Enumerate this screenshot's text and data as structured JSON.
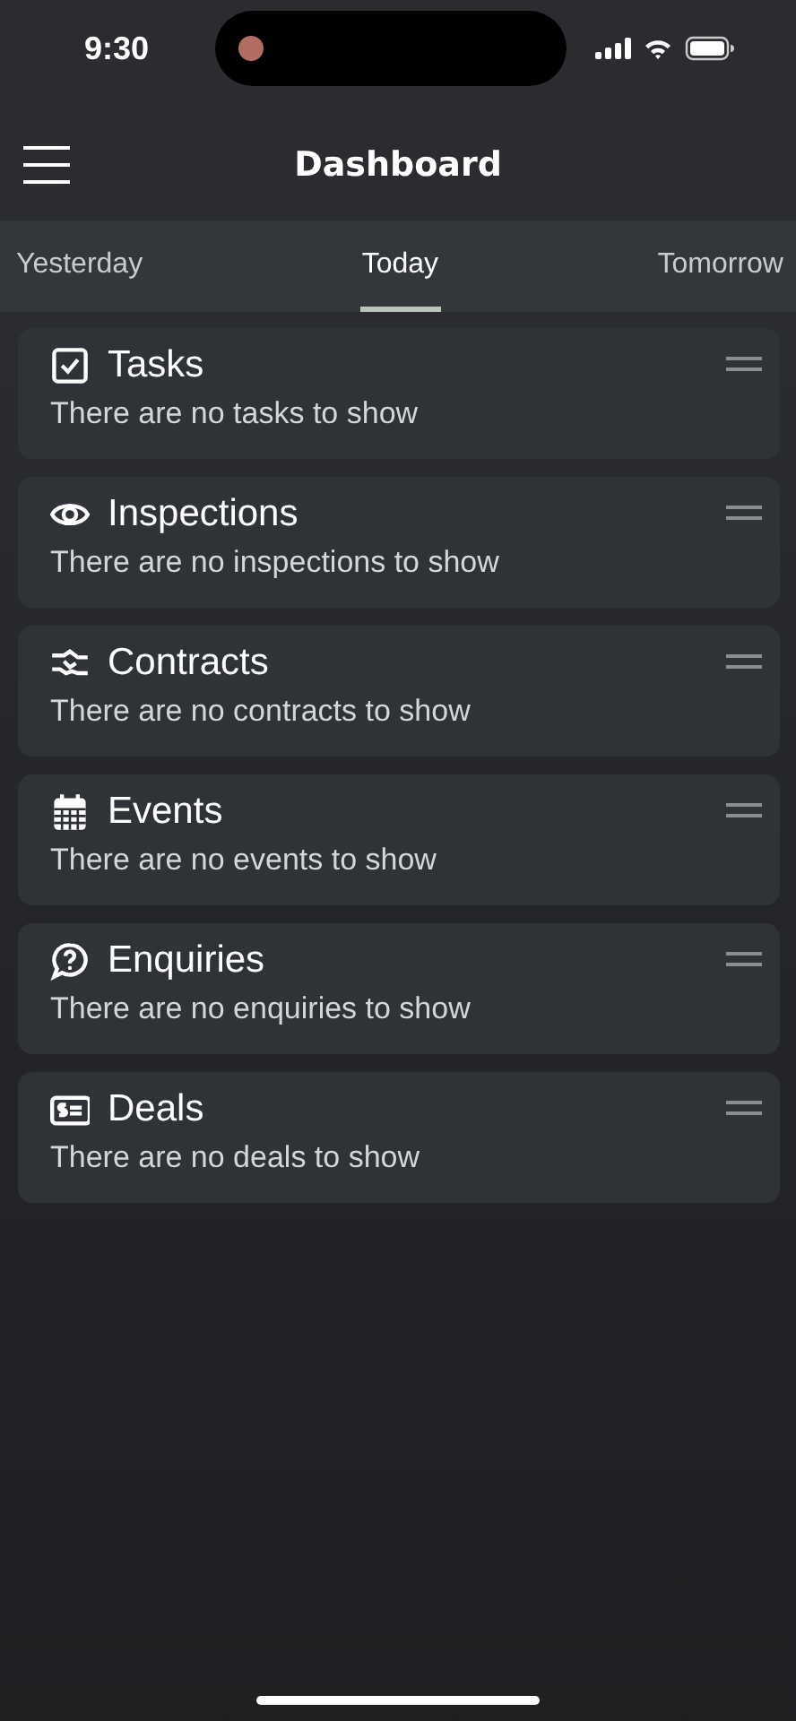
{
  "status_bar": {
    "time": "9:30"
  },
  "header": {
    "title": "Dashboard"
  },
  "tabs": [
    {
      "label": "Yesterday",
      "selected": false
    },
    {
      "label": "Today",
      "selected": true
    },
    {
      "label": "Tomorrow",
      "selected": false
    }
  ],
  "cards": [
    {
      "kind": "tasks",
      "title": "Tasks",
      "message": "There are no tasks to show"
    },
    {
      "kind": "inspections",
      "title": "Inspections",
      "message": "There are no inspections to show"
    },
    {
      "kind": "contracts",
      "title": "Contracts",
      "message": "There are no contracts to show"
    },
    {
      "kind": "events",
      "title": "Events",
      "message": "There are no events to show"
    },
    {
      "kind": "enquiries",
      "title": "Enquiries",
      "message": "There are no enquiries to show"
    },
    {
      "kind": "deals",
      "title": "Deals",
      "message": "There are no deals to show"
    }
  ]
}
